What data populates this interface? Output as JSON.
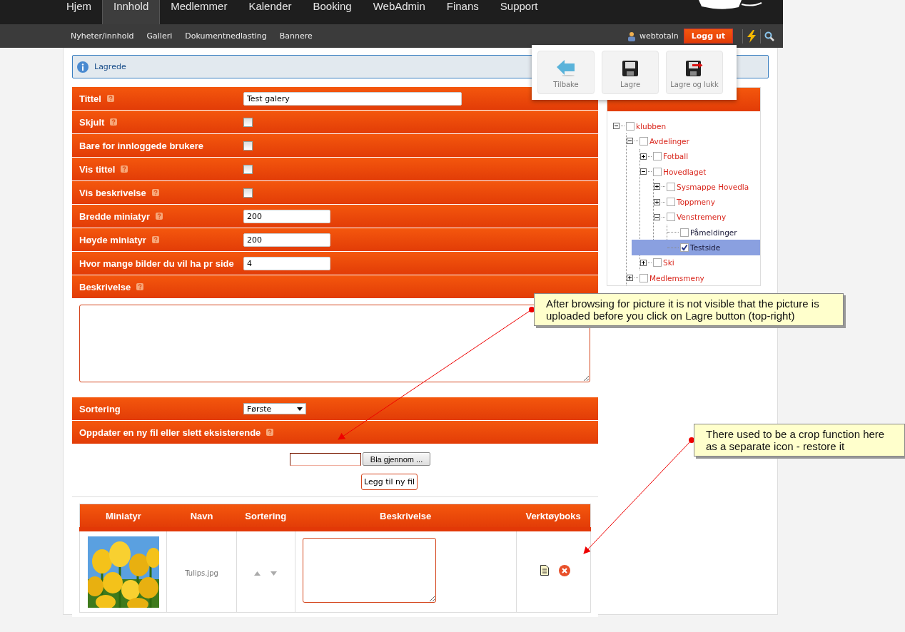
{
  "top_nav": {
    "tabs": [
      {
        "label": "Hjem",
        "selected": false
      },
      {
        "label": "Innhold",
        "selected": true
      },
      {
        "label": "Medlemmer",
        "selected": false
      },
      {
        "label": "Kalender",
        "selected": false
      },
      {
        "label": "Booking",
        "selected": false
      },
      {
        "label": "WebAdmin",
        "selected": false
      },
      {
        "label": "Finans",
        "selected": false
      },
      {
        "label": "Support",
        "selected": false
      }
    ]
  },
  "sub_nav": {
    "items": [
      "Nyheter/innhold",
      "Galleri",
      "Dokumentnedlasting",
      "Bannere"
    ],
    "user": "webtotaln",
    "logout": "Logg ut"
  },
  "toolbar": {
    "buttons": [
      {
        "kind": "back",
        "label": "Tilbake"
      },
      {
        "kind": "save",
        "label": "Lagre"
      },
      {
        "kind": "save_close",
        "label": "Lagre og lukk"
      }
    ]
  },
  "notice": "Lagrede",
  "form": {
    "rows": [
      {
        "kind": "text",
        "label": "Tittel",
        "help": true,
        "value": "Test galery",
        "wide": true
      },
      {
        "kind": "checkbox",
        "label": "Skjult",
        "help": true,
        "checked": false
      },
      {
        "kind": "checkbox",
        "label": "Bare for innloggede brukere",
        "help": false,
        "checked": false
      },
      {
        "kind": "checkbox",
        "label": "Vis tittel",
        "help": true,
        "checked": false
      },
      {
        "kind": "checkbox",
        "label": "Vis beskrivelse",
        "help": true,
        "checked": false
      },
      {
        "kind": "text",
        "label": "Bredde miniatyr",
        "help": true,
        "value": "200",
        "wide": false
      },
      {
        "kind": "text",
        "label": "Høyde miniatyr",
        "help": true,
        "value": "200",
        "wide": false
      },
      {
        "kind": "text",
        "label": "Hvor mange bilder du vil ha pr side",
        "help": false,
        "value": "4",
        "wide": false
      },
      {
        "kind": "heading",
        "label": "Beskrivelse",
        "help": true
      },
      {
        "kind": "textarea"
      },
      {
        "kind": "select",
        "label": "Sortering",
        "help": false,
        "value": "Første"
      },
      {
        "kind": "heading",
        "label": "Oppdater en ny fil eller slett eksisterende",
        "help": true
      }
    ]
  },
  "upload": {
    "browse_button": "Bla gjennom ...",
    "add_button": "Legg til ny fil"
  },
  "files_table": {
    "columns": [
      "Miniatyr",
      "Navn",
      "Sortering",
      "Beskrivelse",
      "Verktøyboks"
    ],
    "rows": [
      {
        "name": "Tulips.jpg"
      }
    ]
  },
  "placement_panel": {
    "tree": [
      {
        "label": "klubben",
        "kind": "folder",
        "expanded": true,
        "checked": false,
        "selected": false,
        "children": [
          {
            "label": "Avdelinger",
            "kind": "folder",
            "expanded": true,
            "checked": false,
            "selected": false,
            "children": [
              {
                "label": "Fotball",
                "kind": "folder",
                "expanded": false,
                "checked": false,
                "selected": false
              },
              {
                "label": "Hovedlaget",
                "kind": "folder",
                "expanded": true,
                "checked": false,
                "selected": false,
                "children": [
                  {
                    "label": "Sysmappe Hovedla",
                    "kind": "folder",
                    "expanded": false,
                    "checked": false,
                    "selected": false
                  },
                  {
                    "label": "Toppmeny",
                    "kind": "folder",
                    "expanded": false,
                    "checked": false,
                    "selected": false
                  },
                  {
                    "label": "Venstremeny",
                    "kind": "folder",
                    "expanded": true,
                    "checked": false,
                    "selected": false,
                    "children": [
                      {
                        "label": "Påmeldinger",
                        "kind": "page",
                        "checked": false,
                        "selected": false
                      },
                      {
                        "label": "Testside",
                        "kind": "page",
                        "checked": true,
                        "selected": true
                      }
                    ]
                  }
                ]
              },
              {
                "label": "Ski",
                "kind": "folder",
                "expanded": false,
                "checked": false,
                "selected": false
              }
            ]
          },
          {
            "label": "Medlemsmeny",
            "kind": "folder",
            "expanded": false,
            "checked": false,
            "selected": false
          }
        ]
      }
    ]
  },
  "annotations": [
    {
      "text": "After browsing for picture it is not visible that the picture is uploaded before you click on Lagre button (top-right)"
    },
    {
      "text": "There used to be a crop function here as a separate icon - restore it"
    }
  ]
}
